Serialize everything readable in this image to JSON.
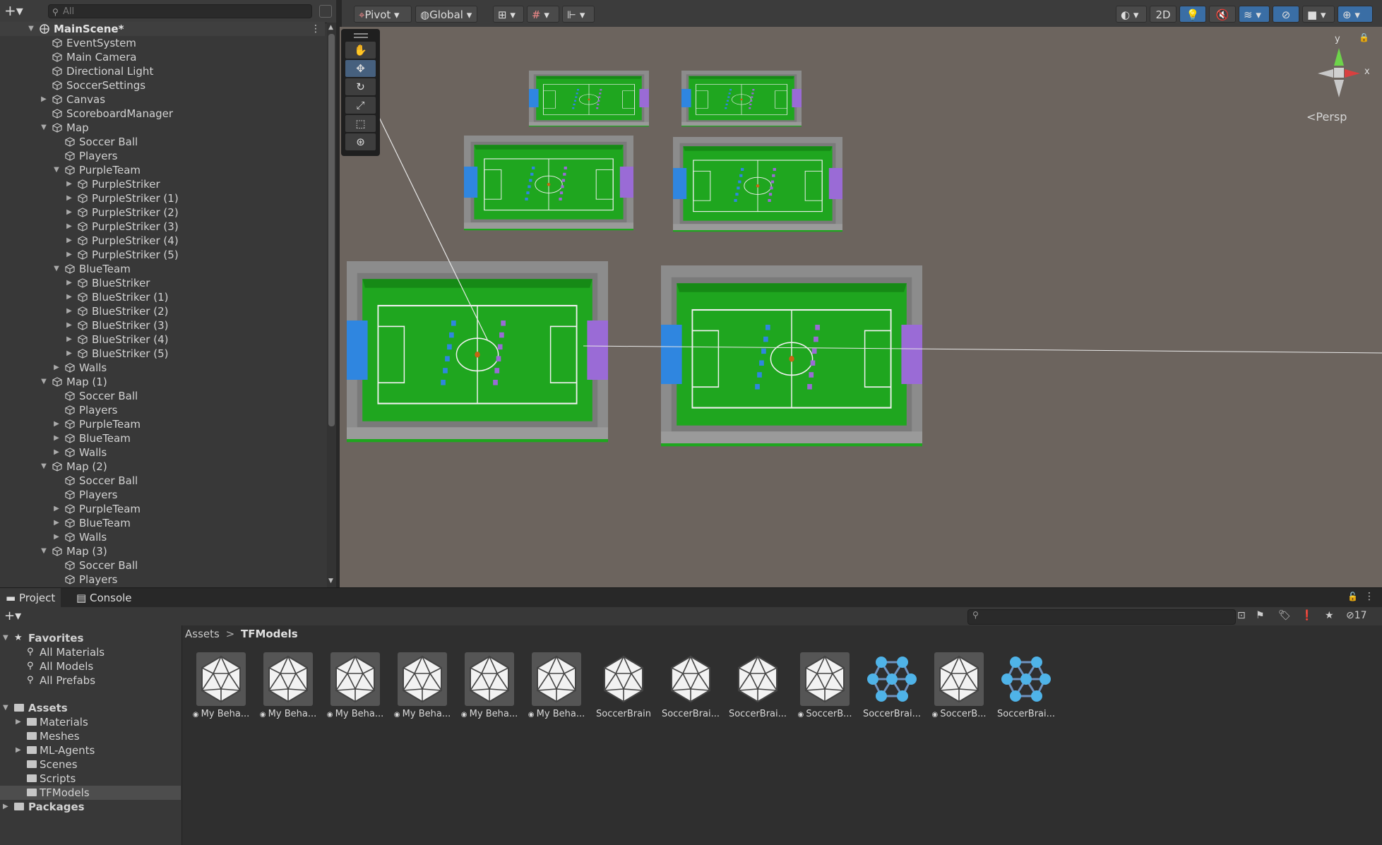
{
  "hierarchy": {
    "add_label": "+▾",
    "search_placeholder": "All",
    "scene_name": "MainScene*",
    "rows": [
      {
        "label": "MainScene*",
        "depth": 0,
        "arrow": "down",
        "scene": true
      },
      {
        "label": "EventSystem",
        "depth": 1,
        "arrow": ""
      },
      {
        "label": "Main Camera",
        "depth": 1,
        "arrow": ""
      },
      {
        "label": "Directional Light",
        "depth": 1,
        "arrow": ""
      },
      {
        "label": "SoccerSettings",
        "depth": 1,
        "arrow": ""
      },
      {
        "label": "Canvas",
        "depth": 1,
        "arrow": "right"
      },
      {
        "label": "ScoreboardManager",
        "depth": 1,
        "arrow": ""
      },
      {
        "label": "Map",
        "depth": 1,
        "arrow": "down"
      },
      {
        "label": "Soccer Ball",
        "depth": 2,
        "arrow": ""
      },
      {
        "label": "Players",
        "depth": 2,
        "arrow": ""
      },
      {
        "label": "PurpleTeam",
        "depth": 2,
        "arrow": "down"
      },
      {
        "label": "PurpleStriker",
        "depth": 3,
        "arrow": "right"
      },
      {
        "label": "PurpleStriker (1)",
        "depth": 3,
        "arrow": "right"
      },
      {
        "label": "PurpleStriker (2)",
        "depth": 3,
        "arrow": "right"
      },
      {
        "label": "PurpleStriker (3)",
        "depth": 3,
        "arrow": "right"
      },
      {
        "label": "PurpleStriker (4)",
        "depth": 3,
        "arrow": "right"
      },
      {
        "label": "PurpleStriker (5)",
        "depth": 3,
        "arrow": "right"
      },
      {
        "label": "BlueTeam",
        "depth": 2,
        "arrow": "down"
      },
      {
        "label": "BlueStriker",
        "depth": 3,
        "arrow": "right"
      },
      {
        "label": "BlueStriker (1)",
        "depth": 3,
        "arrow": "right"
      },
      {
        "label": "BlueStriker (2)",
        "depth": 3,
        "arrow": "right"
      },
      {
        "label": "BlueStriker (3)",
        "depth": 3,
        "arrow": "right"
      },
      {
        "label": "BlueStriker (4)",
        "depth": 3,
        "arrow": "right"
      },
      {
        "label": "BlueStriker (5)",
        "depth": 3,
        "arrow": "right"
      },
      {
        "label": "Walls",
        "depth": 2,
        "arrow": "right"
      },
      {
        "label": "Map (1)",
        "depth": 1,
        "arrow": "down"
      },
      {
        "label": "Soccer Ball",
        "depth": 2,
        "arrow": ""
      },
      {
        "label": "Players",
        "depth": 2,
        "arrow": ""
      },
      {
        "label": "PurpleTeam",
        "depth": 2,
        "arrow": "right"
      },
      {
        "label": "BlueTeam",
        "depth": 2,
        "arrow": "right"
      },
      {
        "label": "Walls",
        "depth": 2,
        "arrow": "right"
      },
      {
        "label": "Map (2)",
        "depth": 1,
        "arrow": "down"
      },
      {
        "label": "Soccer Ball",
        "depth": 2,
        "arrow": ""
      },
      {
        "label": "Players",
        "depth": 2,
        "arrow": ""
      },
      {
        "label": "PurpleTeam",
        "depth": 2,
        "arrow": "right"
      },
      {
        "label": "BlueTeam",
        "depth": 2,
        "arrow": "right"
      },
      {
        "label": "Walls",
        "depth": 2,
        "arrow": "right"
      },
      {
        "label": "Map (3)",
        "depth": 1,
        "arrow": "down"
      },
      {
        "label": "Soccer Ball",
        "depth": 2,
        "arrow": ""
      },
      {
        "label": "Players",
        "depth": 2,
        "arrow": ""
      }
    ]
  },
  "scene_toolbar": {
    "pivot": "Pivot",
    "global": "Global",
    "mode_2d": "2D"
  },
  "scene_view": {
    "camera_mode": "Persp",
    "gizmo_y": "y",
    "gizmo_x": "x",
    "field_green": "#1fa61f",
    "wall_gray": "#8a8a8a",
    "team_blue": "#2f86e0",
    "team_purple": "#9a6bd6"
  },
  "bottom_tabs": {
    "project": "Project",
    "console": "Console"
  },
  "project": {
    "hidden_count": "17",
    "favorites": {
      "label": "Favorites",
      "items": [
        "All Materials",
        "All Models",
        "All Prefabs"
      ]
    },
    "assets": {
      "label": "Assets",
      "folders": [
        {
          "label": "Materials",
          "arrow": true
        },
        {
          "label": "Meshes",
          "arrow": false
        },
        {
          "label": "ML-Agents",
          "arrow": true
        },
        {
          "label": "Scenes",
          "arrow": false
        },
        {
          "label": "Scripts",
          "arrow": false
        },
        {
          "label": "TFModels",
          "arrow": false,
          "selected": true
        }
      ]
    },
    "packages": "Packages",
    "breadcrumb": {
      "root": "Assets",
      "sep": ">",
      "current": "TFModels"
    },
    "items": [
      {
        "label": "My Beha...",
        "kind": "model",
        "badge": true
      },
      {
        "label": "My Beha...",
        "kind": "model",
        "badge": true
      },
      {
        "label": "My Beha...",
        "kind": "model",
        "badge": true
      },
      {
        "label": "My Beha...",
        "kind": "model",
        "badge": true
      },
      {
        "label": "My Beha...",
        "kind": "model",
        "badge": true
      },
      {
        "label": "My Beha...",
        "kind": "model",
        "badge": true
      },
      {
        "label": "SoccerBrain",
        "kind": "model-plain",
        "badge": false
      },
      {
        "label": "SoccerBrai...",
        "kind": "model-plain",
        "badge": false
      },
      {
        "label": "SoccerBrai...",
        "kind": "model-plain",
        "badge": false
      },
      {
        "label": "SoccerB...",
        "kind": "model",
        "badge": true
      },
      {
        "label": "SoccerBrai...",
        "kind": "network",
        "badge": false
      },
      {
        "label": "SoccerB...",
        "kind": "model",
        "badge": true
      },
      {
        "label": "SoccerBrai...",
        "kind": "network",
        "badge": false
      }
    ]
  }
}
